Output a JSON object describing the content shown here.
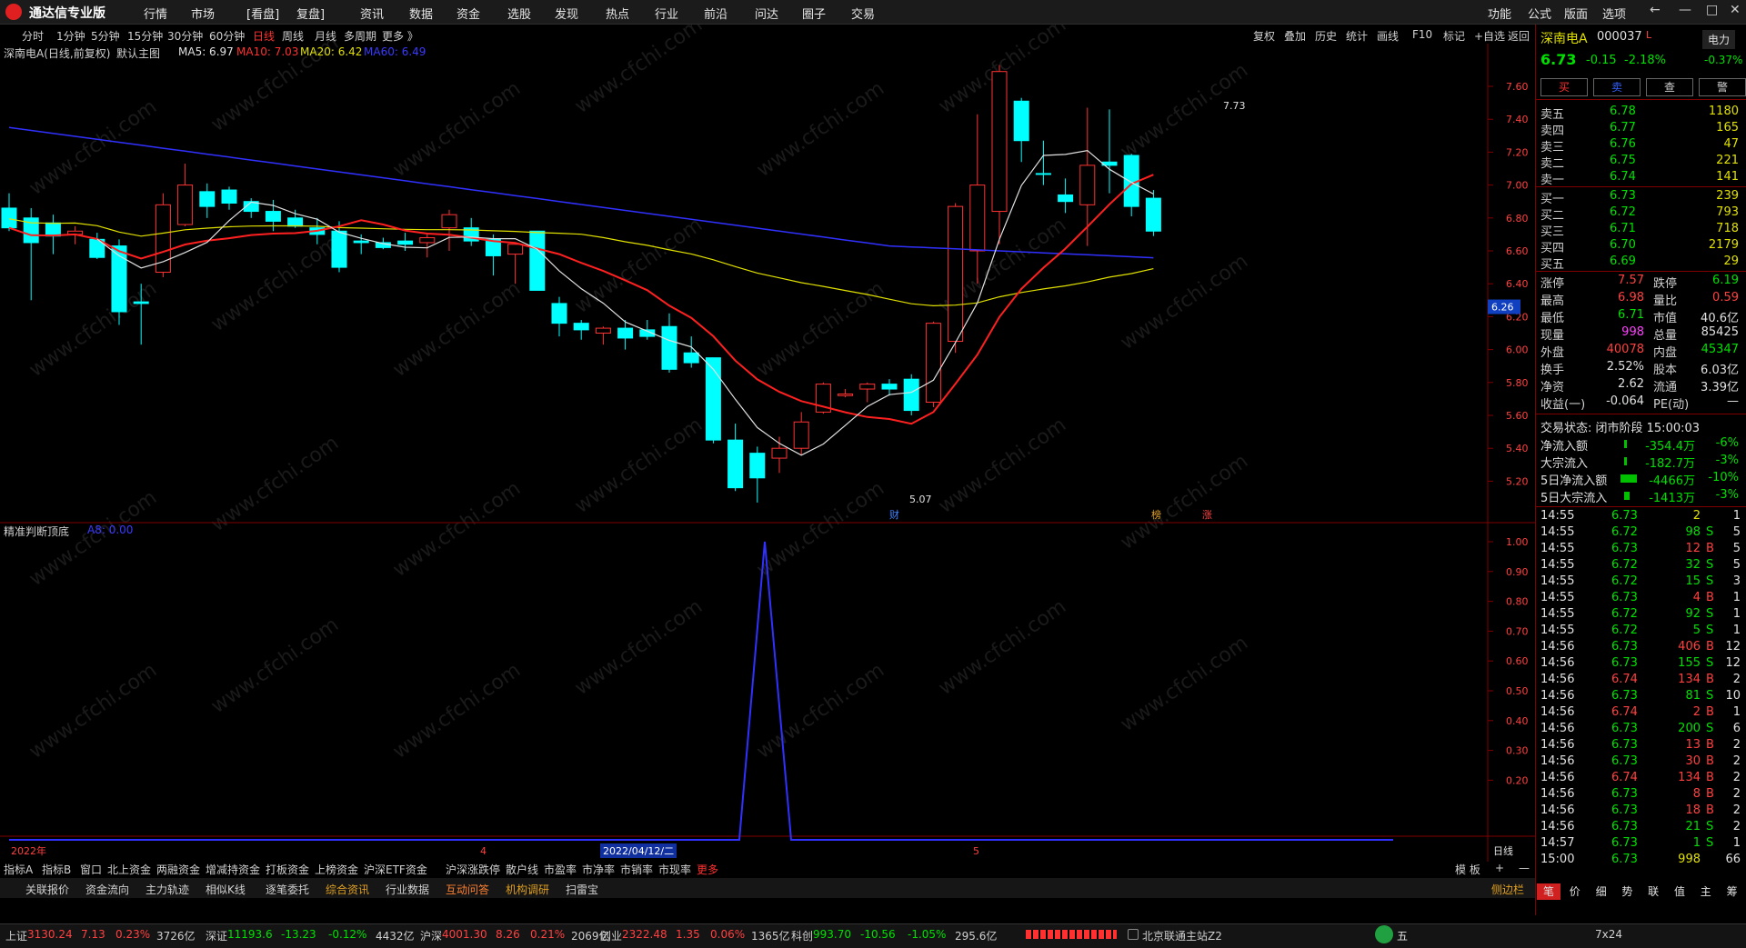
{
  "app": {
    "title": "通达信专业版"
  },
  "menubar": {
    "items": [
      "行情",
      "市场",
      "[看盘]",
      "复盘]",
      "资讯",
      "数据",
      "资金",
      "选股",
      "发现",
      "热点",
      "行业",
      "前沿",
      "问达",
      "圈子",
      "交易"
    ],
    "right": [
      "功能",
      "公式",
      "版面",
      "选项"
    ],
    "window": [
      "←",
      "—",
      "□",
      "✕"
    ]
  },
  "periods": [
    "分时",
    "1分钟",
    "5分钟",
    "15分钟",
    "30分钟",
    "60分钟",
    "日线",
    "周线",
    "月线",
    "多周期",
    "更多 》"
  ],
  "active_period": "日线",
  "toolbar_right": [
    "复权",
    "叠加",
    "历史",
    "统计",
    "画线",
    "F10",
    "标记",
    "+自选",
    "返回"
  ],
  "chart_header": {
    "name": "深南电A(日线,前复权)",
    "main": "默认主图",
    "ma5": "MA5: 6.97",
    "ma10": "MA10: 7.03",
    "ma20": "MA20: 6.42",
    "ma60": "MA60: 6.49"
  },
  "colors": {
    "up": "#ff3232",
    "down": "#00ffff",
    "ma5": "#e0e0e0",
    "ma10": "#ff2020",
    "ma20": "#e0e000",
    "ma60": "#3030ff",
    "sub": "#3030ff"
  },
  "price_axis": [
    "7.60",
    "7.40",
    "7.20",
    "7.00",
    "6.80",
    "6.60",
    "6.40",
    "6.20",
    "6.00",
    "5.80",
    "5.60",
    "5.40",
    "5.20"
  ],
  "price_marker": "6.26",
  "annotations": {
    "high": "7.73",
    "low": "5.07",
    "cai": "财",
    "bang": "榜",
    "zhang": "涨"
  },
  "sub_header": {
    "name": "精准判断顶底",
    "val": "A8: 0.00"
  },
  "sub_axis": [
    "1.00",
    "0.90",
    "0.80",
    "0.70",
    "0.60",
    "0.50",
    "0.40",
    "0.30",
    "0.20"
  ],
  "sub_data": {
    "peak": 1.0,
    "base": 0.0
  },
  "date_axis": {
    "left": "2022年",
    "mid1": "4",
    "sel": "2022/04/12/二",
    "mid2": "5",
    "right": "日线"
  },
  "bottom_tabs1": [
    "指标A",
    "指标B",
    "窗口",
    "北上资金",
    "两融资金",
    "增减持资金",
    "打板资金",
    "上榜资金",
    "沪深ETF资金",
    "沪深涨跌停",
    "散户线",
    "市盈率",
    "市净率",
    "市销率",
    "市现率",
    "更多"
  ],
  "bottom_tabs1_right": [
    "模 板",
    "+",
    "—"
  ],
  "bottom_tabs2": [
    "关联报价",
    "资金流向",
    "主力轨迹",
    "相似K线",
    "逐笔委托",
    "综合资讯",
    "行业数据",
    "互动问答",
    "机构调研",
    "扫雷宝"
  ],
  "bottom_tabs2_right": "侧边栏",
  "stock": {
    "name": "深南电A",
    "code": "000037",
    "flag": "L",
    "price": "6.73",
    "chg": "-0.15",
    "pct": "-2.18%",
    "sector": "电力",
    "sector_pct": "-0.37%"
  },
  "trade_buttons": [
    "买",
    "卖",
    "查",
    "警"
  ],
  "asks": [
    [
      "卖五",
      "6.78",
      "1180"
    ],
    [
      "卖四",
      "6.77",
      "165"
    ],
    [
      "卖三",
      "6.76",
      "47"
    ],
    [
      "卖二",
      "6.75",
      "221"
    ],
    [
      "卖一",
      "6.74",
      "141"
    ]
  ],
  "bids": [
    [
      "买一",
      "6.73",
      "239"
    ],
    [
      "买二",
      "6.72",
      "793"
    ],
    [
      "买三",
      "6.71",
      "718"
    ],
    [
      "买四",
      "6.70",
      "2179"
    ],
    [
      "买五",
      "6.69",
      "29"
    ]
  ],
  "stats": [
    [
      "涨停",
      "7.57",
      "跌停",
      "6.19"
    ],
    [
      "最高",
      "6.98",
      "量比",
      "0.59"
    ],
    [
      "最低",
      "6.71",
      "市值",
      "40.6亿"
    ],
    [
      "现量",
      "998",
      "总量",
      "85425"
    ],
    [
      "外盘",
      "40078",
      "内盘",
      "45347"
    ],
    [
      "换手",
      "2.52%",
      "股本",
      "6.03亿"
    ],
    [
      "净资",
      "2.62",
      "流通",
      "3.39亿"
    ],
    [
      "收益(一)",
      "-0.064",
      "PE(动)",
      "—"
    ]
  ],
  "trade_state": "交易状态: 闭市阶段 15:00:03",
  "flows": [
    [
      "净流入额",
      "-354.4万",
      "-6%"
    ],
    [
      "大宗流入",
      "-182.7万",
      "-3%"
    ],
    [
      "5日净流入额",
      "-4466万",
      "-10%"
    ],
    [
      "5日大宗流入",
      "-1413万",
      "-3%"
    ]
  ],
  "ticks": [
    [
      "14:55",
      "6.73",
      "2",
      "",
      "1"
    ],
    [
      "14:55",
      "6.72",
      "98",
      "S",
      "5"
    ],
    [
      "14:55",
      "6.73",
      "12",
      "B",
      "5"
    ],
    [
      "14:55",
      "6.72",
      "32",
      "S",
      "5"
    ],
    [
      "14:55",
      "6.72",
      "15",
      "S",
      "3"
    ],
    [
      "14:55",
      "6.73",
      "4",
      "B",
      "1"
    ],
    [
      "14:55",
      "6.72",
      "92",
      "S",
      "1"
    ],
    [
      "14:55",
      "6.72",
      "5",
      "S",
      "1"
    ],
    [
      "14:56",
      "6.73",
      "406",
      "B",
      "12"
    ],
    [
      "14:56",
      "6.73",
      "155",
      "S",
      "12"
    ],
    [
      "14:56",
      "6.74",
      "134",
      "B",
      "2"
    ],
    [
      "14:56",
      "6.73",
      "81",
      "S",
      "10"
    ],
    [
      "14:56",
      "6.74",
      "2",
      "B",
      "1"
    ],
    [
      "14:56",
      "6.73",
      "200",
      "S",
      "6"
    ],
    [
      "14:56",
      "6.73",
      "13",
      "B",
      "2"
    ],
    [
      "14:56",
      "6.73",
      "30",
      "B",
      "2"
    ],
    [
      "14:56",
      "6.74",
      "134",
      "B",
      "2"
    ],
    [
      "14:56",
      "6.73",
      "8",
      "B",
      "2"
    ],
    [
      "14:56",
      "6.73",
      "18",
      "B",
      "2"
    ],
    [
      "14:56",
      "6.73",
      "21",
      "S",
      "2"
    ],
    [
      "14:57",
      "6.73",
      "1",
      "S",
      "1"
    ],
    [
      "15:00",
      "6.73",
      "998",
      "",
      "66"
    ]
  ],
  "side_tabs": [
    "笔",
    "价",
    "细",
    "势",
    "联",
    "值",
    "主",
    "筹"
  ],
  "status": {
    "sh": [
      "上证",
      "3130.24",
      "7.13",
      "0.23%",
      "3726亿"
    ],
    "sz": [
      "深证",
      "11193.6",
      "-13.23",
      "-0.12%",
      "4432亿"
    ],
    "hs": [
      "沪深",
      "4001.30",
      "8.26",
      "0.21%",
      "2069亿"
    ],
    "cy": [
      "创业",
      "2322.48",
      "1.35",
      "0.06%",
      "1365亿"
    ],
    "kc": [
      "科创",
      "993.70",
      "-10.56",
      "-1.05%",
      "295.6亿"
    ],
    "server": "北京联通主站Z2",
    "time": "7x24",
    "ime": "五"
  },
  "watermark": "www.cfchi.com"
}
